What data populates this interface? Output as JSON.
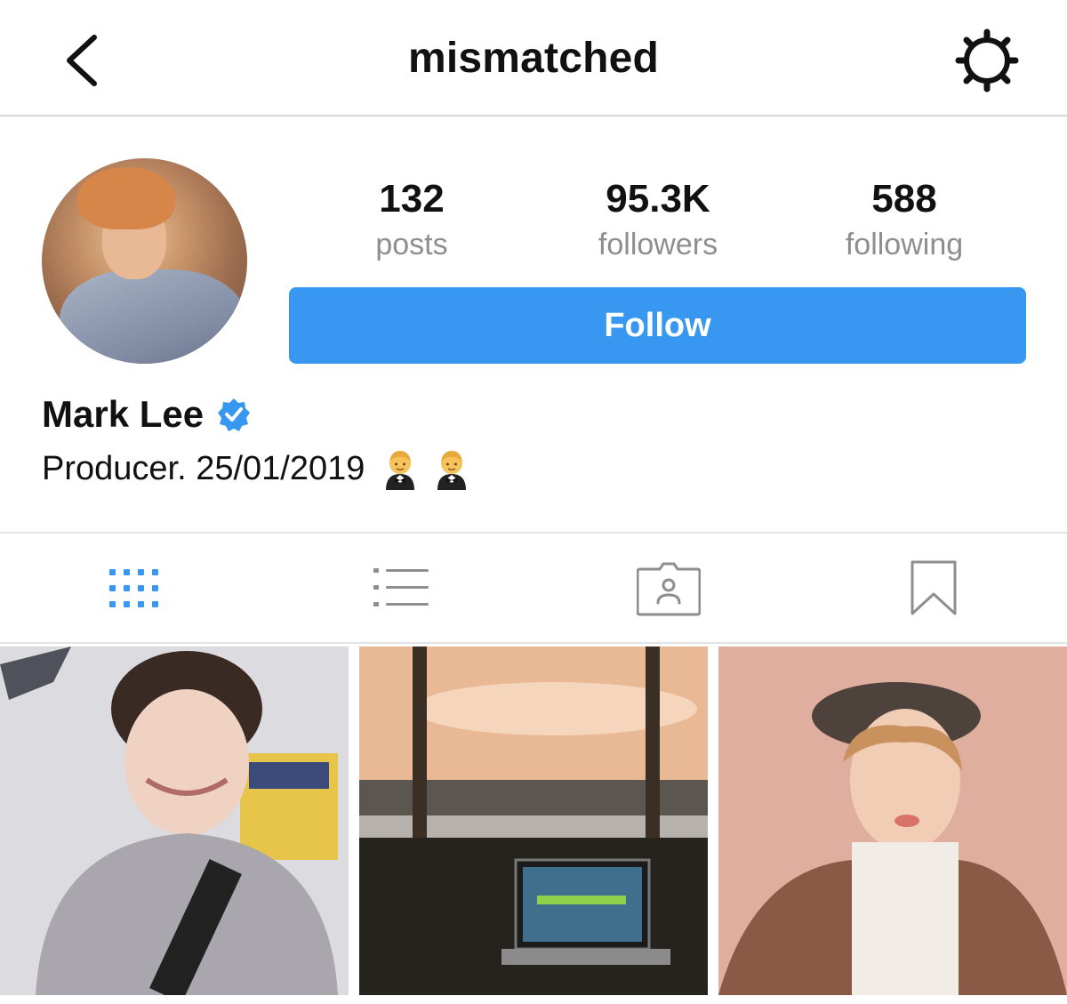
{
  "header": {
    "title": "mismatched",
    "back_icon": "chevron-left-icon",
    "settings_icon": "gear-icon"
  },
  "profile": {
    "avatar": "profile-avatar",
    "stats": [
      {
        "value": "132",
        "label": "posts"
      },
      {
        "value": "95.3K",
        "label": "followers"
      },
      {
        "value": "588",
        "label": "following"
      }
    ],
    "follow_label": "Follow",
    "name": "Mark Lee",
    "verified": true,
    "bio": "Producer. 25/01/2019",
    "bio_emoji": [
      "man-in-tuxedo",
      "man-in-tuxedo"
    ]
  },
  "tabs": [
    {
      "icon": "grid-icon",
      "active": true
    },
    {
      "icon": "list-icon",
      "active": false
    },
    {
      "icon": "tagged-icon",
      "active": false
    },
    {
      "icon": "bookmark-icon",
      "active": false
    }
  ],
  "colors": {
    "accent": "#3897f0",
    "muted": "#8e8e8e",
    "divider": "#e3e3e3"
  }
}
